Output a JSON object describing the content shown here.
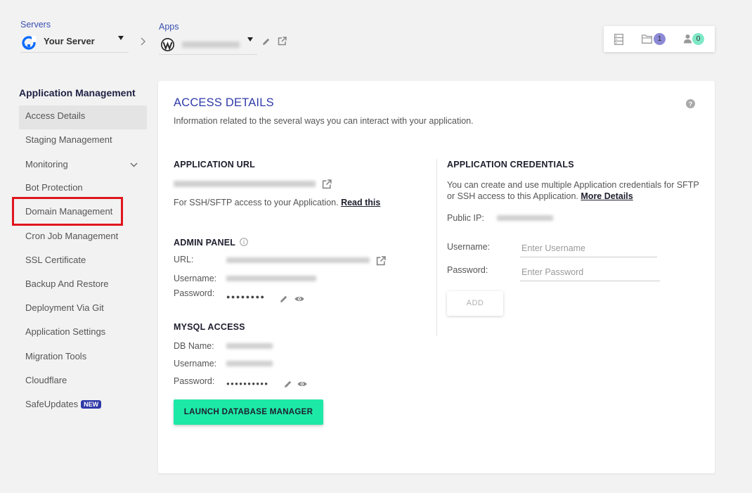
{
  "breadcrumb": {
    "servers_label": "Servers",
    "server_name": "Your Server",
    "apps_label": "Apps"
  },
  "topbar": {
    "files_count": "1",
    "users_count": "0",
    "files_badge_color": "#8c89d6",
    "users_badge_color": "#7fe8c6"
  },
  "sidebar": {
    "title": "Application Management",
    "items": [
      {
        "label": "Access Details"
      },
      {
        "label": "Staging Management"
      },
      {
        "label": "Monitoring"
      },
      {
        "label": "Bot Protection"
      },
      {
        "label": "Domain Management"
      },
      {
        "label": "Cron Job Management"
      },
      {
        "label": "SSL Certificate"
      },
      {
        "label": "Backup And Restore"
      },
      {
        "label": "Deployment Via Git"
      },
      {
        "label": "Application Settings"
      },
      {
        "label": "Migration Tools"
      },
      {
        "label": "Cloudflare"
      },
      {
        "label": "SafeUpdates",
        "badge": "NEW"
      }
    ]
  },
  "main": {
    "title": "ACCESS DETAILS",
    "description": "Information related to the several ways you can interact with your application.",
    "app_url": {
      "heading": "APPLICATION URL",
      "ssh_note": "For SSH/SFTP access to your Application.",
      "read_this": "Read this"
    },
    "admin_panel": {
      "heading": "ADMIN PANEL",
      "url_label": "URL:",
      "username_label": "Username:",
      "password_label": "Password:",
      "password_mask": "●●●●●●●●"
    },
    "mysql": {
      "heading": "MYSQL ACCESS",
      "dbname_label": "DB Name:",
      "username_label": "Username:",
      "password_label": "Password:",
      "password_mask": "●●●●●●●●●●",
      "launch_button": "LAUNCH DATABASE MANAGER"
    },
    "credentials": {
      "heading": "APPLICATION CREDENTIALS",
      "desc_line1": "You can create and use multiple Application credentials for SFTP",
      "desc_line2": "or SSH access to this Application.",
      "more_details": "More Details",
      "public_ip_label": "Public IP:",
      "username_label": "Username:",
      "password_label": "Password:",
      "username_placeholder": "Enter Username",
      "password_placeholder": "Enter Password",
      "add_button": "ADD"
    }
  },
  "colors": {
    "accent": "#2f3aa8",
    "launch_button": "#1de9a7",
    "highlight_box": "#e0151e"
  }
}
